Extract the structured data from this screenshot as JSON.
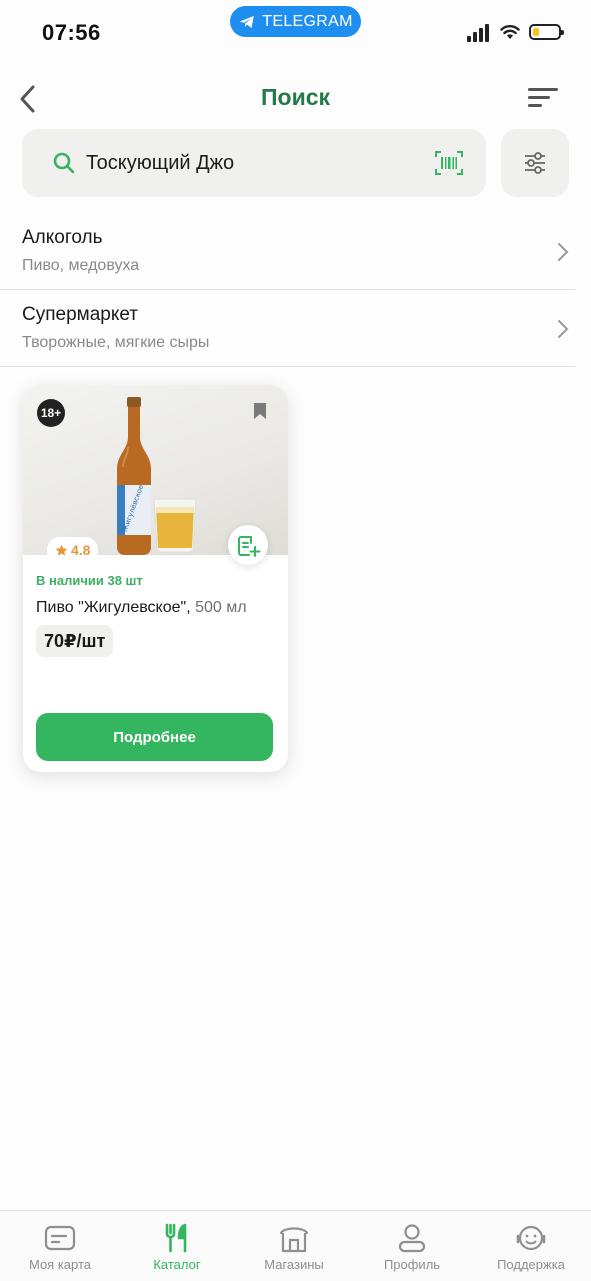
{
  "status_bar": {
    "time": "07:56",
    "app_pill": "TELEGRAM",
    "battery_level": 0.25
  },
  "header": {
    "title": "Поиск"
  },
  "search": {
    "value": "Тоскующий Джо",
    "placeholder": ""
  },
  "categories": [
    {
      "title": "Алкоголь",
      "subtitle": "Пиво, медовуха"
    },
    {
      "title": "Супермаркет",
      "subtitle": "Творожные, мягкие сыры"
    }
  ],
  "product": {
    "age_badge": "18+",
    "rating": "4.8",
    "stock": "В наличии 38 шт",
    "name": "Пиво \"Жигулевское\",",
    "volume": "500 мл",
    "price": "70₽/шт",
    "details_button": "Подробнее"
  },
  "bottom_nav": [
    {
      "label": "Моя карта",
      "icon": "card-icon",
      "active": false
    },
    {
      "label": "Каталог",
      "icon": "cutlery-icon",
      "active": true
    },
    {
      "label": "Магазины",
      "icon": "store-icon",
      "active": false
    },
    {
      "label": "Профиль",
      "icon": "person-icon",
      "active": false
    },
    {
      "label": "Поддержка",
      "icon": "support-icon",
      "active": false
    }
  ],
  "colors": {
    "accent_green": "#34b55f",
    "title_green": "#247a4a",
    "telegram_blue": "#1f8ef1",
    "rating_orange": "#e8963a"
  }
}
